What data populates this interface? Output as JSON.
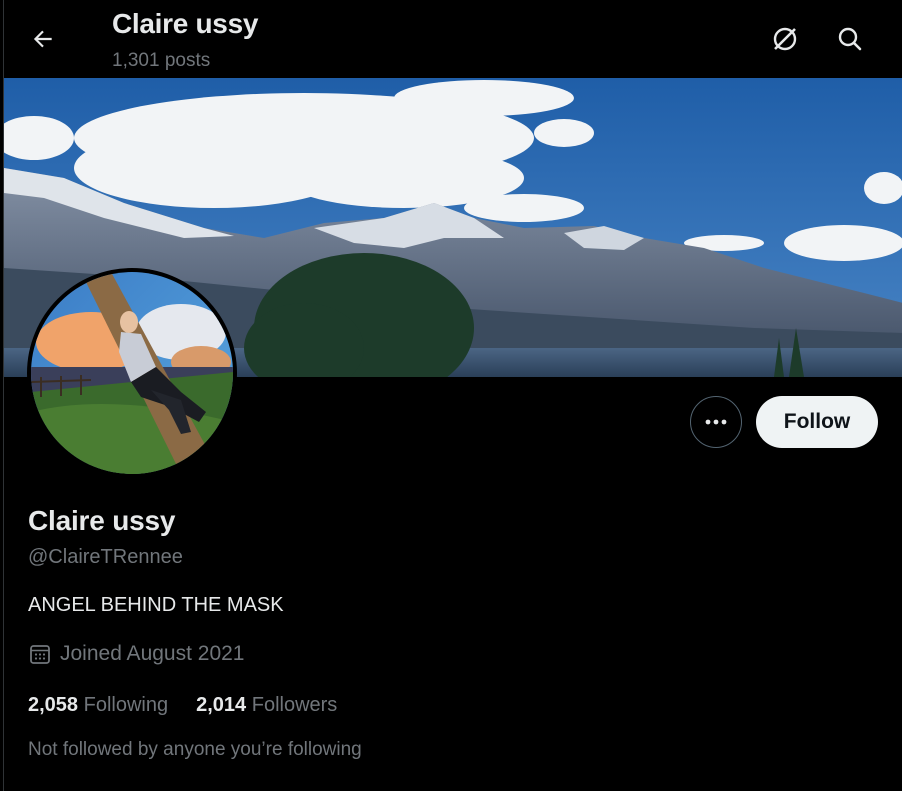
{
  "header": {
    "title": "Claire ussy",
    "post_count": "1,301 posts",
    "back_icon": "arrow-left-icon",
    "grok_icon": "grok-icon",
    "search_icon": "search-icon"
  },
  "profile": {
    "display_name": "Claire ussy",
    "handle": "@ClaireTRennee",
    "bio": "ANGEL BEHIND THE MASK",
    "joined": "Joined August 2021",
    "following_count": "2,058",
    "following_label": "Following",
    "followers_count": "2,014",
    "followers_label": "Followers",
    "followed_by_text": "Not followed by anyone you’re following"
  },
  "actions": {
    "more_icon": "more-dots-icon",
    "follow_label": "Follow"
  },
  "colors": {
    "background": "#000000",
    "primary_text": "#e7e9ea",
    "secondary_text": "#71767b",
    "follow_button_bg": "#eff3f4"
  }
}
